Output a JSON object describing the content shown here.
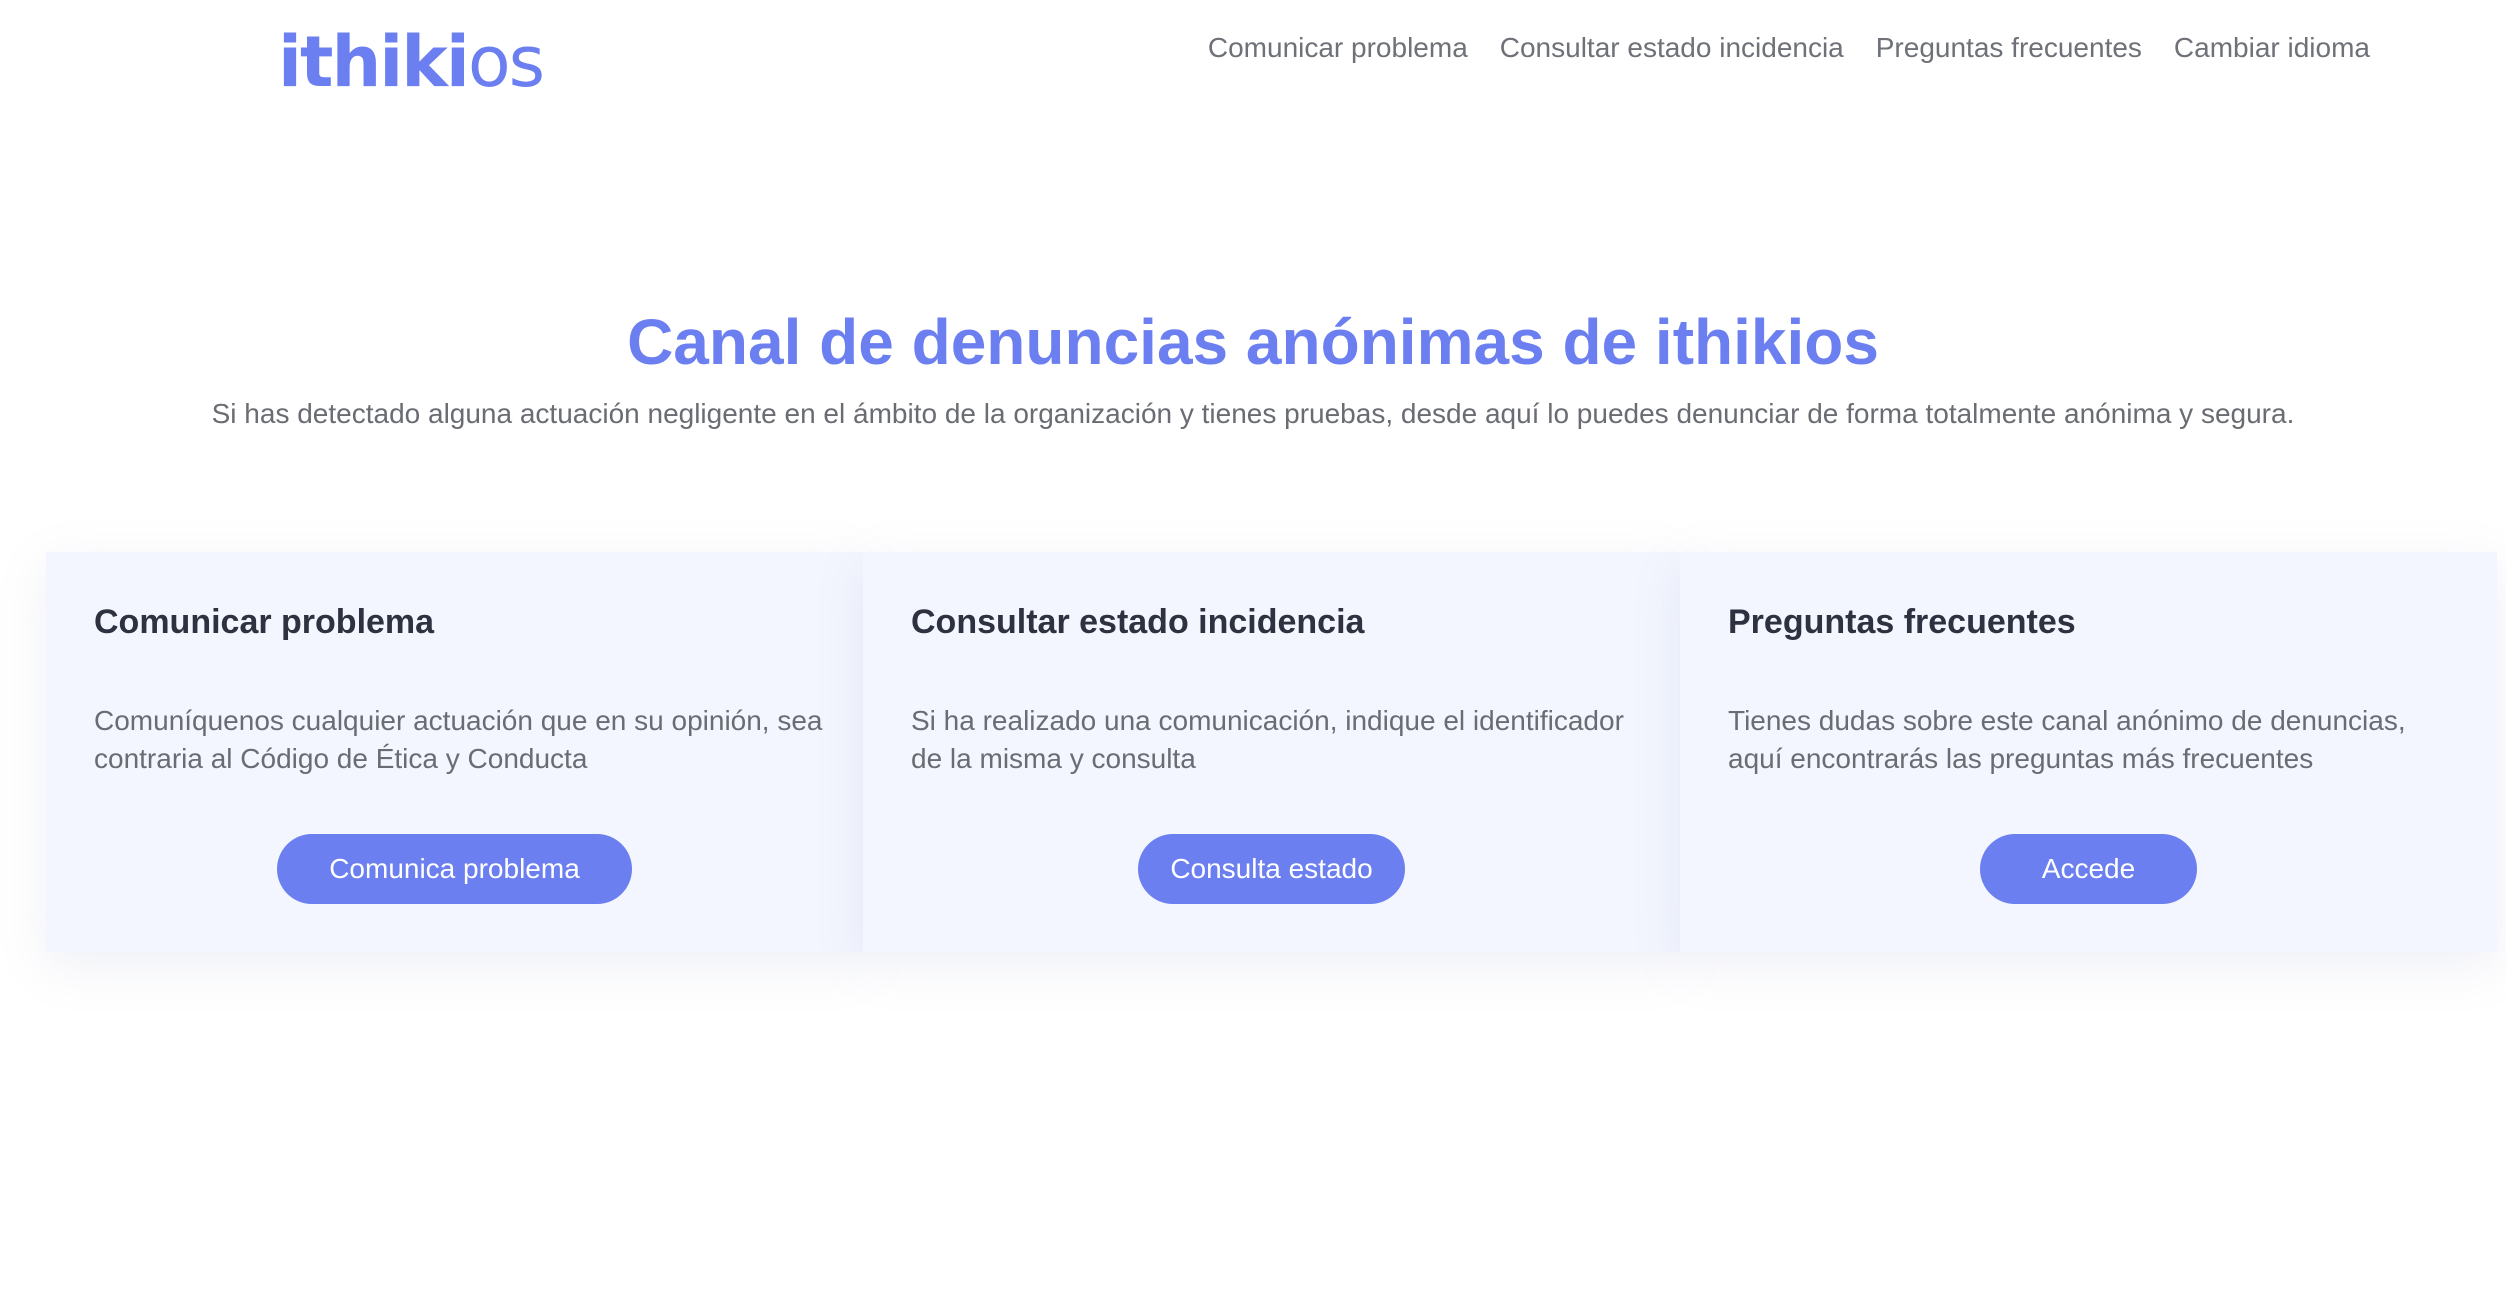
{
  "header": {
    "logo_strong": "ithiki",
    "logo_light": "os",
    "nav": [
      "Comunicar problema",
      "Consultar estado incidencia",
      "Preguntas frecuentes",
      "Cambiar idioma"
    ]
  },
  "hero": {
    "title": "Canal de denuncias anónimas de ithikios",
    "subtitle": "Si has detectado alguna actuación negligente en el ámbito de la organización y tienes pruebas, desde aquí lo puedes denunciar de forma totalmente anónima y segura."
  },
  "cards": [
    {
      "title": "Comunicar problema",
      "text": "Comuníquenos cualquier actuación que en su opinión, sea contraria al Código de Ética y Conducta",
      "button": "Comunica problema"
    },
    {
      "title": "Consultar estado incidencia",
      "text": "Si ha realizado una comunicación, indique el identificador de la misma y consulta",
      "button": "Consulta estado"
    },
    {
      "title": "Preguntas frecuentes",
      "text": "Tienes dudas sobre este canal anónimo de denuncias, aquí encontrarás las preguntas más frecuentes",
      "button": "Accede"
    }
  ],
  "colors": {
    "accent": "#6b7ff0",
    "card_background": "#f3f6fe",
    "body_text": "#6a6c73",
    "heading_text": "#2d3140"
  }
}
